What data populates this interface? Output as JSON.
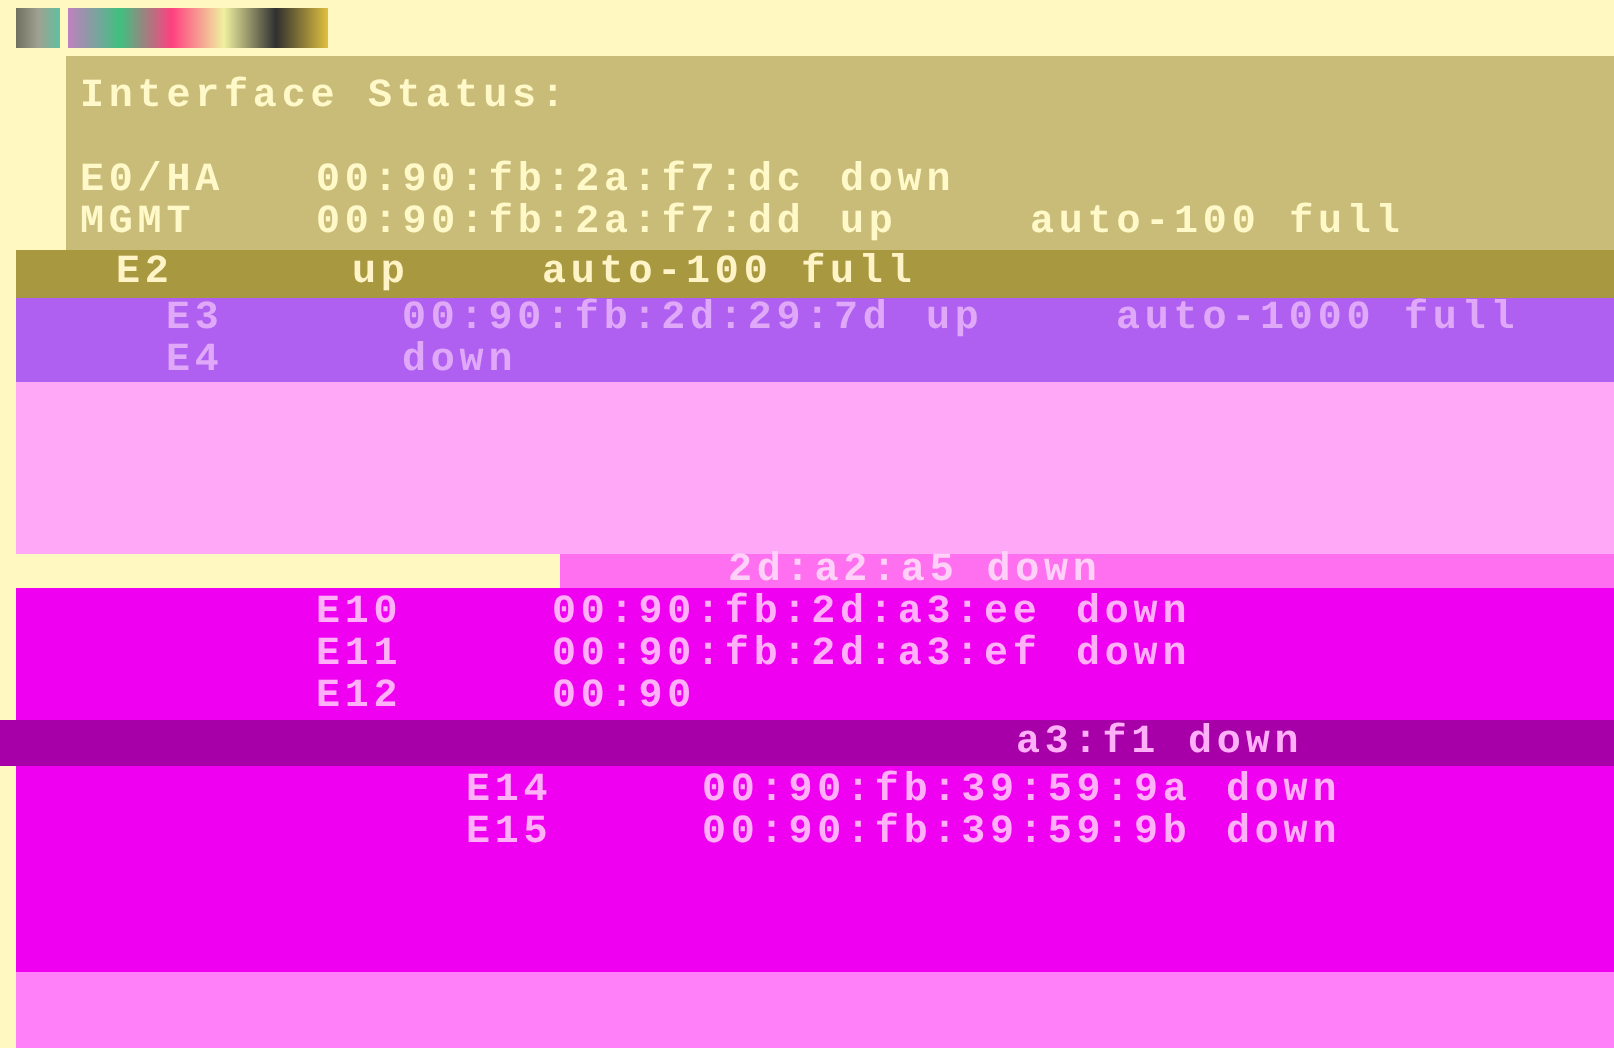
{
  "terminal": {
    "bands": [
      {
        "kind": "khaki",
        "heading": "Interface Status:",
        "rows": [
          {
            "name": "E0/HA",
            "mac": "00:90:fb:2a:f7:dc",
            "state": "down"
          },
          {
            "name": "MGMT",
            "mac": "00:90:fb:2a:f7:dd",
            "state": "up",
            "mode": "auto-100 full"
          }
        ]
      },
      {
        "kind": "olive",
        "rows": [
          {
            "name": "E2",
            "state": "up",
            "mode": "auto-100 full"
          }
        ]
      },
      {
        "kind": "violet",
        "rows": [
          {
            "name": "E3",
            "mac": "00:90:fb:2d:29:7d",
            "state": "up",
            "mode": "auto-1000 full"
          },
          {
            "name": "E4",
            "state": "down"
          }
        ]
      },
      {
        "kind": "pale"
      },
      {
        "kind": "pink",
        "rows": [
          {
            "mac": "2d:a2:a5",
            "state": "down"
          }
        ]
      },
      {
        "kind": "magenta",
        "rows": [
          {
            "name": "E10",
            "mac": "00:90:fb:2d:a3:ee",
            "state": "down"
          },
          {
            "name": "E11",
            "mac": "00:90:fb:2d:a3:ef",
            "state": "down"
          },
          {
            "name": "E12",
            "mac": "00:90"
          }
        ]
      },
      {
        "kind": "plum",
        "rows": [
          {
            "mac": "a3:f1",
            "state": "down"
          }
        ]
      },
      {
        "kind": "magenta2",
        "rows": [
          {
            "name": "E14",
            "mac": "00:90:fb:39:59:9a",
            "state": "down"
          },
          {
            "name": "E15",
            "mac": "00:90:fb:39:59:9b",
            "state": "down"
          }
        ]
      },
      {
        "kind": "footer"
      }
    ]
  }
}
